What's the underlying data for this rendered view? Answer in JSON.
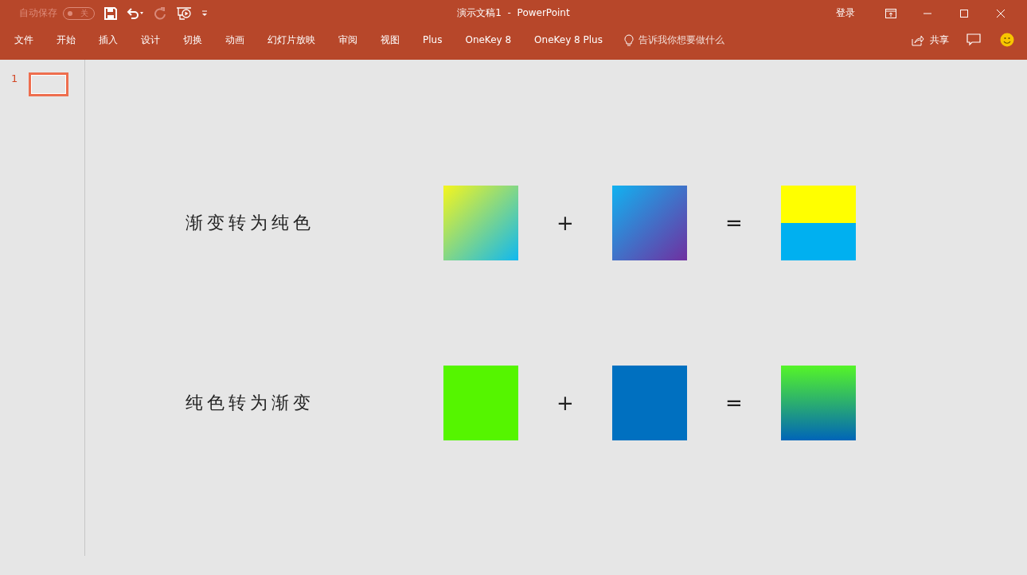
{
  "window": {
    "title": "演示文稿1  -  PowerPoint"
  },
  "autosave": {
    "label": "自动保存",
    "on": false,
    "state_text": "关"
  },
  "account": {
    "sign_in": "登录"
  },
  "ribbon_tabs": [
    {
      "label": "文件",
      "selected": false
    },
    {
      "label": "开始",
      "selected": false
    },
    {
      "label": "插入",
      "selected": false
    },
    {
      "label": "设计",
      "selected": false
    },
    {
      "label": "切换",
      "selected": false
    },
    {
      "label": "动画",
      "selected": false
    },
    {
      "label": "幻灯片放映",
      "selected": false
    },
    {
      "label": "审阅",
      "selected": false
    },
    {
      "label": "视图",
      "selected": false
    },
    {
      "label": "Plus",
      "selected": false
    },
    {
      "label": "OneKey 8",
      "selected": false
    },
    {
      "label": "OneKey 8 Plus",
      "selected": false
    }
  ],
  "tell_me": {
    "placeholder": "告诉我你想要做什么"
  },
  "share": {
    "label": "共享"
  },
  "thumbnails": [
    {
      "number": "1",
      "selected": true
    }
  ],
  "slide": {
    "rows": [
      {
        "label": "渐变转为纯色",
        "plus": "+",
        "equals": "=",
        "squares": [
          {
            "kind": "diagonal"
          },
          {
            "kind": "diagonal"
          },
          {
            "kind": "split",
            "parts": [
              {
                "color": "#ffff00"
              },
              {
                "color": "#00b0f0"
              }
            ]
          }
        ]
      },
      {
        "label": "纯色转为渐变",
        "plus": "+",
        "equals": "=",
        "squares": [
          {
            "kind": "solid",
            "color": "#55f500"
          },
          {
            "kind": "solid",
            "color": "#0070c0"
          },
          {
            "kind": "vertical"
          }
        ]
      }
    ]
  }
}
